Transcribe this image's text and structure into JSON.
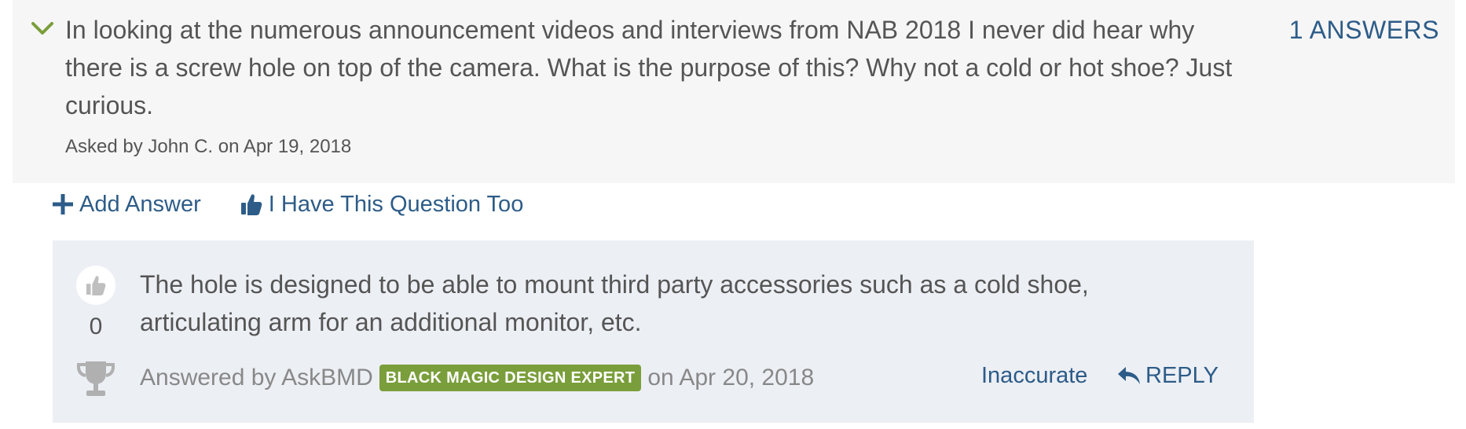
{
  "question": {
    "text": "In looking at the numerous announcement videos and interviews from NAB 2018 I never did hear why there is a screw hole on top of the camera. What is the purpose of this? Why not a cold or hot shoe? Just curious.",
    "asked_by": "Asked by John C. on Apr 19, 2018",
    "answers_count": "1 ANSWERS",
    "toggle_icon": "chevron-down-icon"
  },
  "actions": {
    "add_answer": "Add Answer",
    "add_answer_icon": "plus-icon",
    "have_question": "I Have This Question Too",
    "have_question_icon": "thumbs-up-icon"
  },
  "answer": {
    "text": "The hole is designed to be able to mount third party accessories such as a cold shoe, articulating arm for an additional monitor, etc.",
    "votes": "0",
    "answered_by_prefix": "Answered by AskBMD",
    "badge": "BLACK MAGIC DESIGN EXPERT",
    "answered_on": "on Apr 20, 2018",
    "inaccurate_label": "Inaccurate",
    "reply_label": "REPLY",
    "vote_icon": "thumbs-up-icon",
    "expert_icon": "trophy-icon",
    "reply_icon": "reply-arrow-icon"
  },
  "colors": {
    "link": "#2d5c88",
    "chevron": "#7a9e3b",
    "badge": "#7a9e3b",
    "question_bg": "#f6f6f6",
    "answer_bg": "#eceff4"
  }
}
